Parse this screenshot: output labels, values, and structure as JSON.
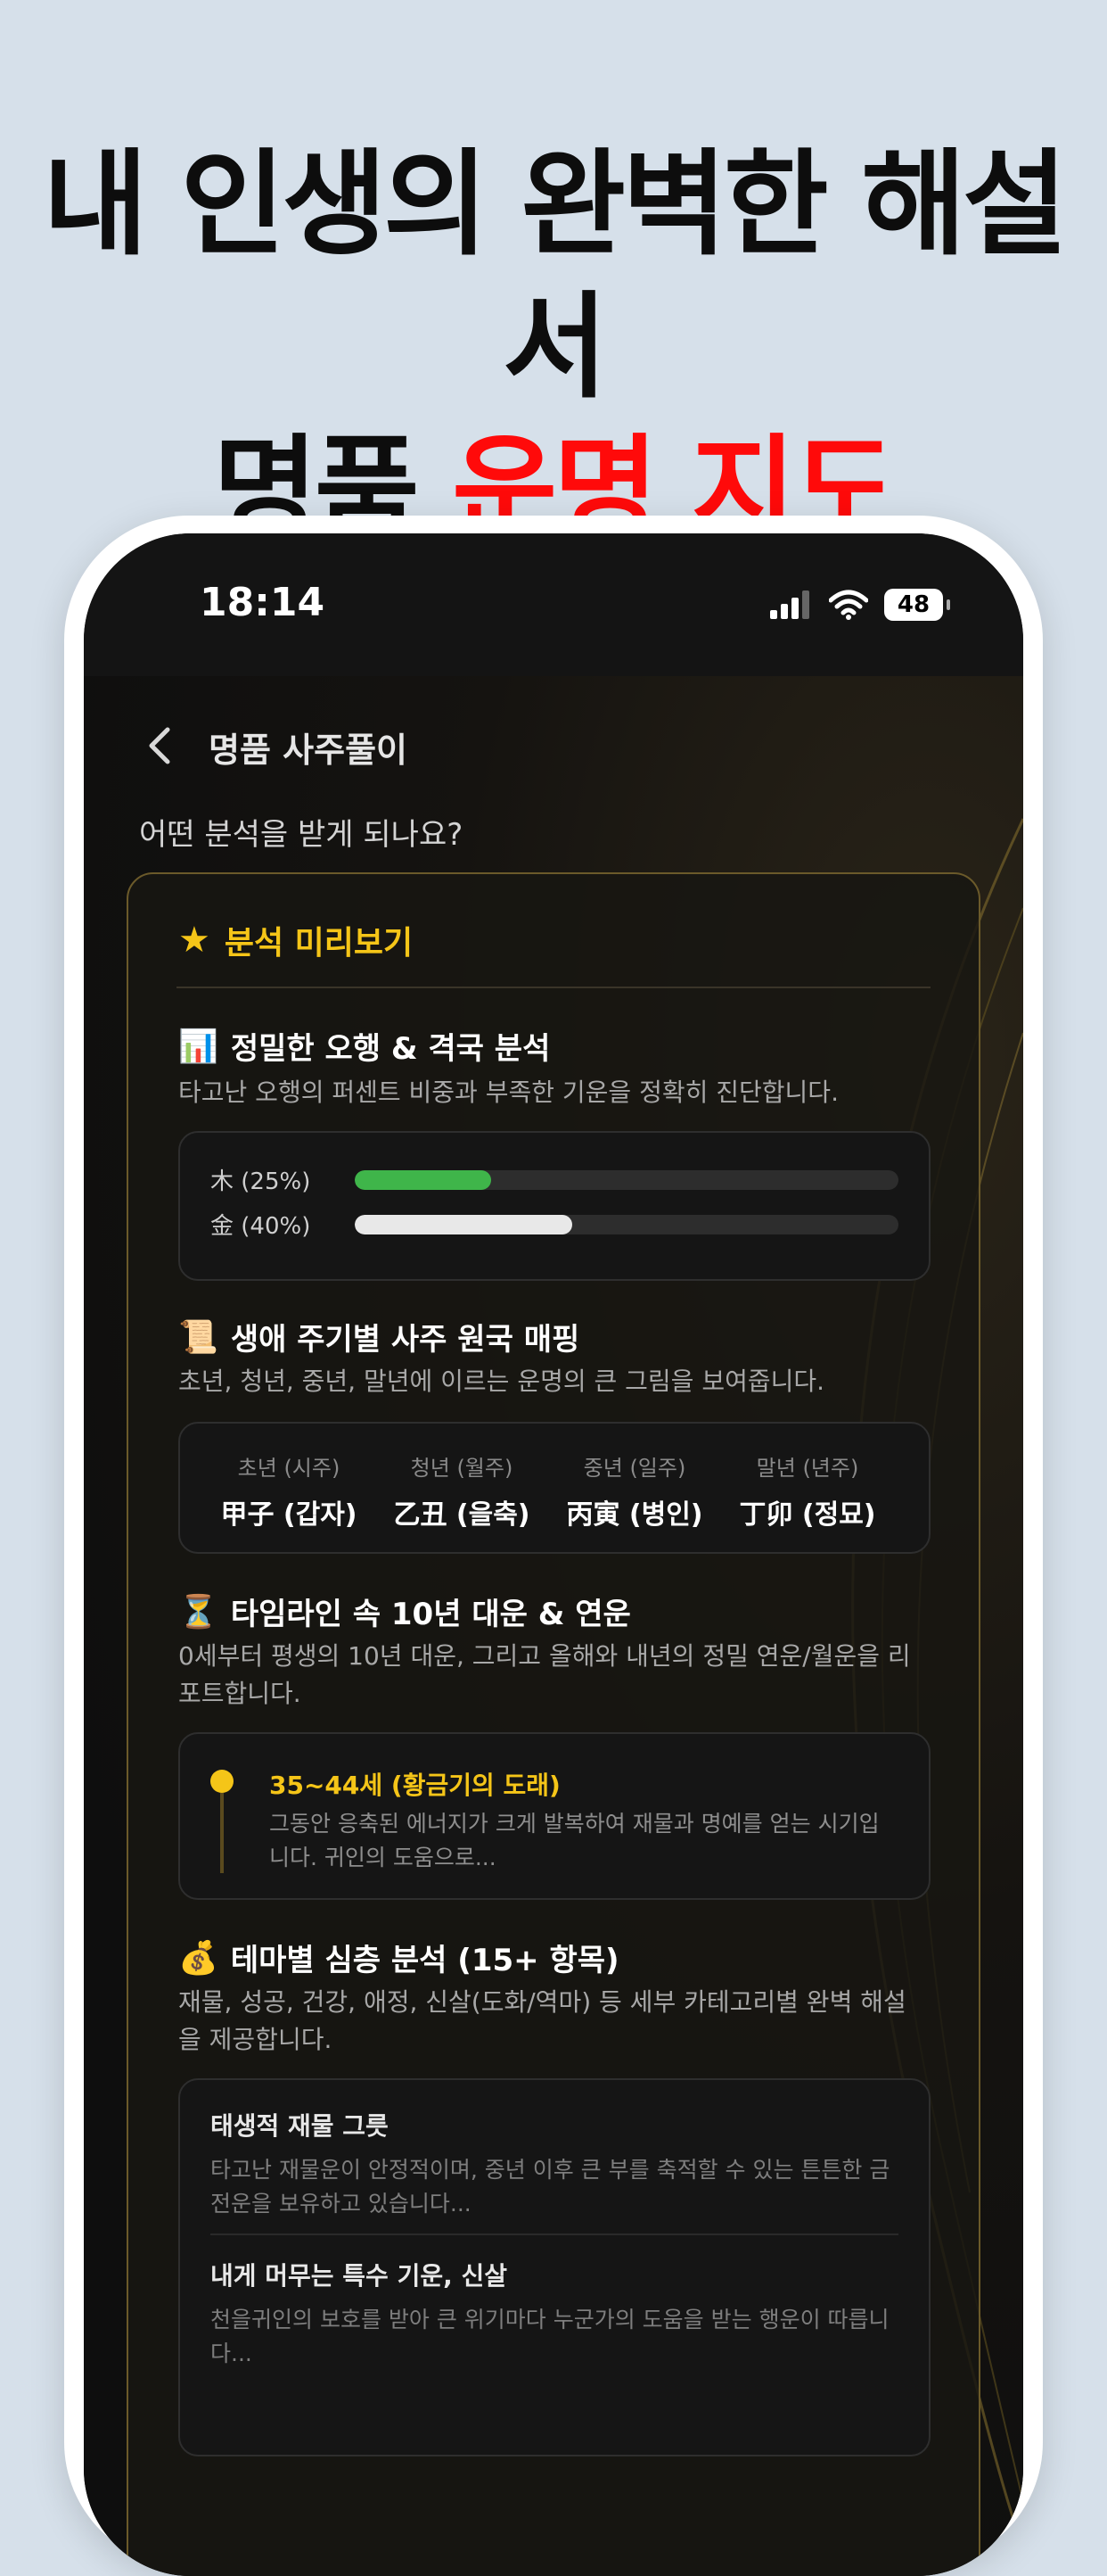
{
  "headline": {
    "line1": "내 인생의 완벽한 해설서",
    "line2_prefix": "명품 ",
    "line2_highlight": "운명 지도",
    "highlight_color": "#ff0a0a"
  },
  "status_bar": {
    "time": "18:14",
    "battery": "48",
    "icons": [
      "signal-icon",
      "wifi-icon",
      "battery-icon"
    ]
  },
  "nav": {
    "back_icon": "chevron-left-icon",
    "title": "명품 사주풀이"
  },
  "question": "어떤 분석을 받게 되나요?",
  "preview": {
    "icon": "star-icon",
    "title": "분석 미리보기",
    "accent_color": "#f5c518"
  },
  "sections": {
    "ohaeng": {
      "emoji": "📊",
      "title": "정밀한 오행 & 격국 분석",
      "desc": "타고난 오행의 퍼센트 비중과 부족한 기운을 정확히 진단합니다.",
      "bars": [
        {
          "label": "木 (25%)",
          "percent": 25,
          "color": "#3fb54a"
        },
        {
          "label": "金 (40%)",
          "percent": 40,
          "color": "#e8e8e8"
        }
      ]
    },
    "pillars": {
      "emoji": "📜",
      "title": "생애 주기별 사주 원국 매핑",
      "desc": "초년, 청년, 중년, 말년에 이르는 운명의 큰 그림을 보여줍니다.",
      "items": [
        {
          "label": "초년 (시주)",
          "value": "甲子 (갑자)"
        },
        {
          "label": "청년 (월주)",
          "value": "乙丑 (을축)"
        },
        {
          "label": "중년 (일주)",
          "value": "丙寅 (병인)"
        },
        {
          "label": "말년 (년주)",
          "value": "丁卯 (정묘)"
        }
      ]
    },
    "timeline": {
      "emoji": "⏳",
      "title": "타임라인 속 10년 대운 & 연운",
      "desc": "0세부터 평생의 10년 대운, 그리고 올해와 내년의 정밀 연운/월운을 리포트합니다.",
      "entry_title": "35~44세 (황금기의 도래)",
      "entry_desc": "그동안 응축된 에너지가 크게 발복하여 재물과 명예를 얻는 시기입니다. 귀인의 도움으로..."
    },
    "themes": {
      "emoji": "💰",
      "title": "테마별 심층 분석 (15+ 항목)",
      "desc": "재물, 성공, 건강, 애정, 신살(도화/역마) 등 세부 카테고리별 완벽 해설을 제공합니다.",
      "items": [
        {
          "title": "태생적 재물 그릇",
          "desc": "타고난 재물운이 안정적이며, 중년 이후 큰 부를 축적할 수 있는 튼튼한 금전운을 보유하고 있습니다..."
        },
        {
          "title": "내게 머무는 특수 기운, 신살",
          "desc": "천을귀인의 보호를 받아 큰 위기마다 누군가의 도움을 받는 행운이 따릅니다..."
        }
      ]
    }
  }
}
